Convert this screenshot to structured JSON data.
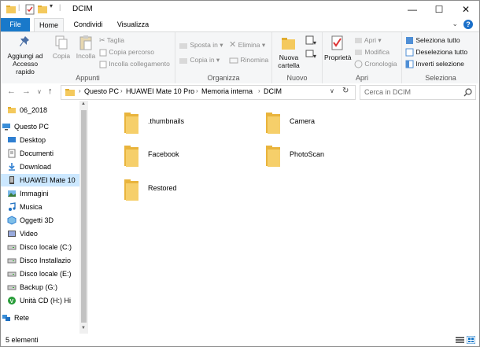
{
  "window": {
    "title": "DCIM"
  },
  "window_controls": {
    "minimize": "—",
    "maximize": "☐",
    "close": "✕"
  },
  "tabs": [
    {
      "label": "File"
    },
    {
      "label": "Home"
    },
    {
      "label": "Condividi"
    },
    {
      "label": "Visualizza"
    }
  ],
  "help": "?",
  "ribbon": {
    "appunti": {
      "label": "Appunti",
      "pin": "Aggiungi ad Accesso rapido",
      "copy": "Copia",
      "paste": "Incolla",
      "cut": "Taglia",
      "copy_path": "Copia percorso",
      "paste_shortcut": "Incolla collegamento"
    },
    "organizza": {
      "label": "Organizza",
      "move": "Sposta in",
      "copy_to": "Copia in",
      "delete": "Elimina",
      "rename": "Rinomina"
    },
    "nuovo": {
      "label": "Nuovo",
      "new_folder": "Nuova cartella"
    },
    "apri": {
      "label": "Apri",
      "properties": "Proprietà",
      "open": "Apri",
      "edit": "Modifica",
      "history": "Cronologia"
    },
    "seleziona": {
      "label": "Seleziona",
      "select_all": "Seleziona tutto",
      "select_none": "Deseleziona tutto",
      "invert": "Inverti selezione"
    }
  },
  "address": {
    "crumbs": [
      "Questo PC",
      "HUAWEI Mate 10 Pro",
      "Memoria interna",
      "DCIM"
    ]
  },
  "search": {
    "placeholder": "Cerca in DCIM"
  },
  "nav_items": [
    {
      "label": "06_2018",
      "icon": "folder-icon",
      "selected": false
    },
    {
      "label": "Questo PC",
      "icon": "pc-icon",
      "selected": false
    },
    {
      "label": "Desktop",
      "icon": "desktop-icon",
      "selected": false
    },
    {
      "label": "Documenti",
      "icon": "documents-icon",
      "selected": false
    },
    {
      "label": "Download",
      "icon": "download-icon",
      "selected": false
    },
    {
      "label": "HUAWEI Mate 10",
      "icon": "phone-icon",
      "selected": true
    },
    {
      "label": "Immagini",
      "icon": "pictures-icon",
      "selected": false
    },
    {
      "label": "Musica",
      "icon": "music-icon",
      "selected": false
    },
    {
      "label": "Oggetti 3D",
      "icon": "objects-3d-icon",
      "selected": false
    },
    {
      "label": "Video",
      "icon": "video-icon",
      "selected": false
    },
    {
      "label": "Disco locale (C:)",
      "icon": "drive-icon",
      "selected": false
    },
    {
      "label": "Disco Installazio",
      "icon": "drive-icon",
      "selected": false
    },
    {
      "label": "Disco locale (E:)",
      "icon": "drive-icon",
      "selected": false
    },
    {
      "label": "Backup (G:)",
      "icon": "drive-icon",
      "selected": false
    },
    {
      "label": "Unità CD (H:) Hi",
      "icon": "cd-icon",
      "selected": false
    },
    {
      "label": "Rete",
      "icon": "network-icon",
      "selected": false
    }
  ],
  "folders": [
    {
      "name": ".thumbnails"
    },
    {
      "name": "Camera"
    },
    {
      "name": "Facebook"
    },
    {
      "name": "PhotoScan"
    },
    {
      "name": "Restored"
    }
  ],
  "status": {
    "text": "5 elementi"
  },
  "colors": {
    "accent": "#1979ca",
    "folder": "#f4c95d",
    "selection": "#cce8ff"
  }
}
